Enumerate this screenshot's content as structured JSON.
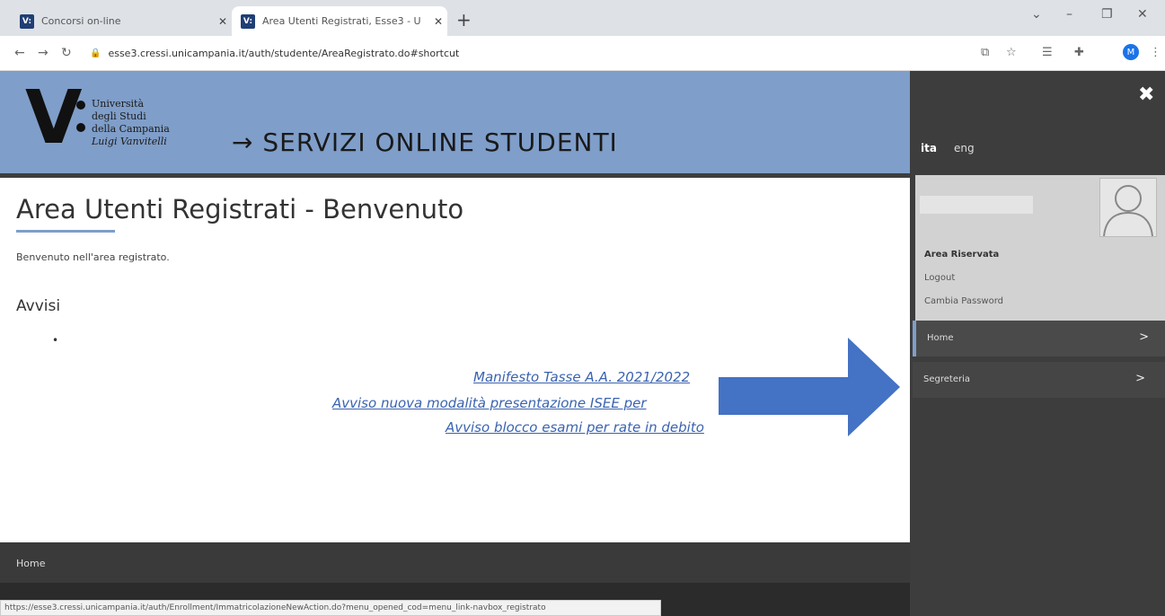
{
  "browser": {
    "tabs": [
      {
        "title": "Concorsi on-line",
        "favicon": "V:"
      },
      {
        "title": "Area Utenti Registrati, Esse3 - U",
        "favicon": "V:"
      }
    ],
    "new_tab": "+",
    "url": "esse3.cressi.unicampania.it/auth/studente/AreaRegistrato.do#shortcut",
    "profile_initial": "M",
    "status_url": "https://esse3.cressi.unicampania.it/auth/Enrollment/ImmatricolazioneNewAction.do?menu_opened_cod=menu_link-navbox_registrato"
  },
  "header": {
    "logo_mark": "V",
    "logo_lines": [
      "Università",
      "degli Studi",
      "della Campania",
      "Luigi Vanvitelli"
    ],
    "title": "→ SERVIZI ONLINE STUDENTI"
  },
  "main": {
    "page_title": "Area Utenti Registrati - Benvenuto",
    "welcome": "Benvenuto nell'area registrato.",
    "section_title": "Avvisi",
    "bullet": "•",
    "notices": [
      "Manifesto Tasse A.A. 2021/2022",
      "Avviso nuova modalità presentazione ISEE per",
      "Avviso blocco esami per rate in debito"
    ]
  },
  "footer": {
    "label": "Home"
  },
  "panel": {
    "close": "✖",
    "lang_ita": "ita",
    "lang_eng": "eng",
    "area_label": "Area Riservata",
    "logout": "Logout",
    "change_password": "Cambia Password",
    "menu": [
      {
        "label": "Home",
        "chevron": ">"
      },
      {
        "label": "Segreteria",
        "chevron": ">"
      }
    ]
  },
  "colors": {
    "header_blue": "#7f9ec9",
    "annotation_blue": "#4472c4",
    "panel_dark": "#3d3d3d"
  }
}
